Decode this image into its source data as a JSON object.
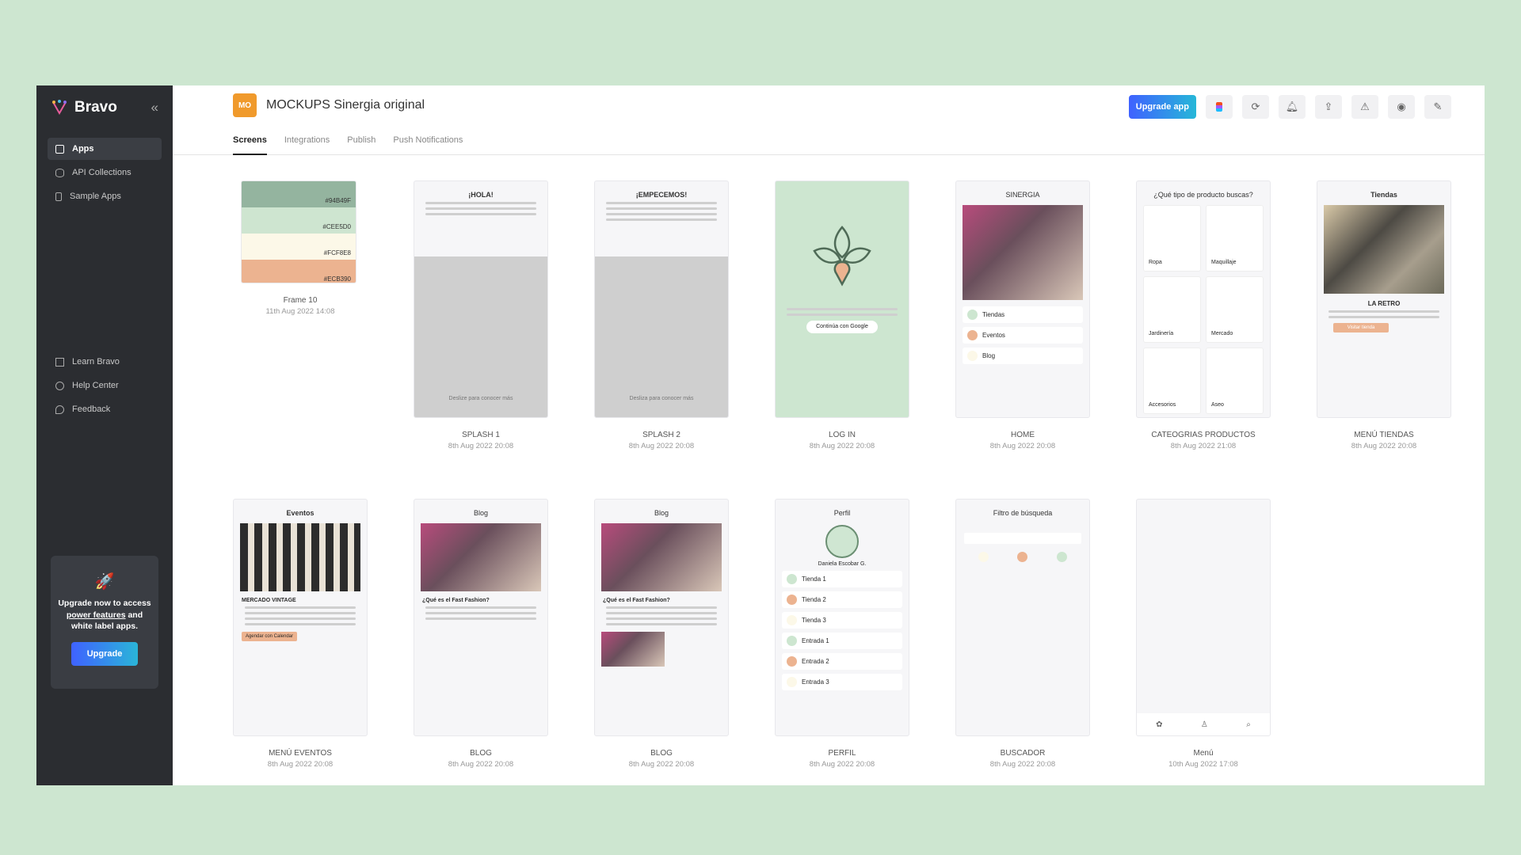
{
  "sidebar": {
    "brand": "Bravo",
    "collapse_icon": "double-chevron-left-icon",
    "nav": [
      {
        "label": "Apps",
        "icon": "folder-icon",
        "active": true
      },
      {
        "label": "API Collections",
        "icon": "database-icon",
        "active": false
      },
      {
        "label": "Sample Apps",
        "icon": "phone-icon",
        "active": false
      }
    ],
    "nav2": [
      {
        "label": "Learn Bravo",
        "icon": "book-icon"
      },
      {
        "label": "Help Center",
        "icon": "help-icon"
      },
      {
        "label": "Feedback",
        "icon": "chat-icon"
      }
    ],
    "upgrade": {
      "text_before": "Upgrade now to access",
      "link": "power features",
      "text_after": "and white label apps.",
      "button": "Upgrade"
    }
  },
  "header": {
    "badge": "MO",
    "title": "MOCKUPS Sinergia original",
    "upgrade_app": "Upgrade app",
    "tools": [
      "figma-icon",
      "refresh-icon",
      "bell-icon",
      "upload-icon",
      "alert-icon",
      "eye-icon",
      "wrench-icon"
    ],
    "tabs": [
      {
        "label": "Screens",
        "active": true
      },
      {
        "label": "Integrations",
        "active": false
      },
      {
        "label": "Publish",
        "active": false
      },
      {
        "label": "Push Notifications",
        "active": false
      }
    ]
  },
  "screens": [
    {
      "name": "Frame 10",
      "date": "11th Aug 2022 14:08",
      "swatches": [
        "#94B49F",
        "#CEE5D0",
        "#FCF8E8",
        "#ECB390"
      ]
    },
    {
      "name": "SPLASH 1",
      "date": "8th Aug 2022 20:08",
      "title": "¡HOLA!",
      "footer": "Deslize para conocer más"
    },
    {
      "name": "SPLASH 2",
      "date": "8th Aug 2022 20:08",
      "title": "¡EMPECEMOS!",
      "footer": "Desliza para conocer más"
    },
    {
      "name": "LOG IN",
      "date": "8th Aug 2022 20:08",
      "button": "Continúa con Google"
    },
    {
      "name": "HOME",
      "date": "8th Aug 2022 20:08",
      "title": "SINERGIA",
      "rows": [
        "Tiendas",
        "Eventos",
        "Blog"
      ]
    },
    {
      "name": "CATEOGRIAS PRODUCTOS",
      "date": "8th Aug 2022 21:08",
      "title": "¿Qué tipo de producto buscas?",
      "cats": [
        "Ropa",
        "Maquillaje",
        "Jardinería",
        "Mercado",
        "Accesorios",
        "Aseo"
      ]
    },
    {
      "name": "MENÚ TIENDAS",
      "date": "8th Aug 2022 20:08",
      "title": "Tiendas",
      "store": "LA RETRO",
      "button": "Visitar tienda"
    },
    {
      "name": "MENÚ EVENTOS",
      "date": "8th Aug 2022 20:08",
      "title": "Eventos",
      "event": "MERCADO VINTAGE",
      "button": "Agendar con Calendar"
    },
    {
      "name": "BLOG",
      "date": "8th Aug 2022 20:08",
      "title": "Blog",
      "heading": "¿Qué es el Fast Fashion?"
    },
    {
      "name": "BLOG",
      "date": "8th Aug 2022 20:08",
      "title": "Blog",
      "heading": "¿Qué es el Fast Fashion?"
    },
    {
      "name": "PERFIL",
      "date": "8th Aug 2022 20:08",
      "title": "Perfil",
      "user": "Daniela Escobar G.",
      "stores": [
        "Tienda 1",
        "Tienda 2",
        "Tienda 3"
      ],
      "entries": [
        "Entrada 1",
        "Entrada 2",
        "Entrada 3"
      ]
    },
    {
      "name": "BUSCADOR",
      "date": "8th Aug 2022 20:08",
      "title": "Filtro de búsqueda"
    },
    {
      "name": "Menú",
      "date": "10th Aug 2022 17:08"
    }
  ],
  "colors": {
    "sidebar": "#2b2d31",
    "accent": "#f09a2c",
    "background": "#cde6d0"
  }
}
